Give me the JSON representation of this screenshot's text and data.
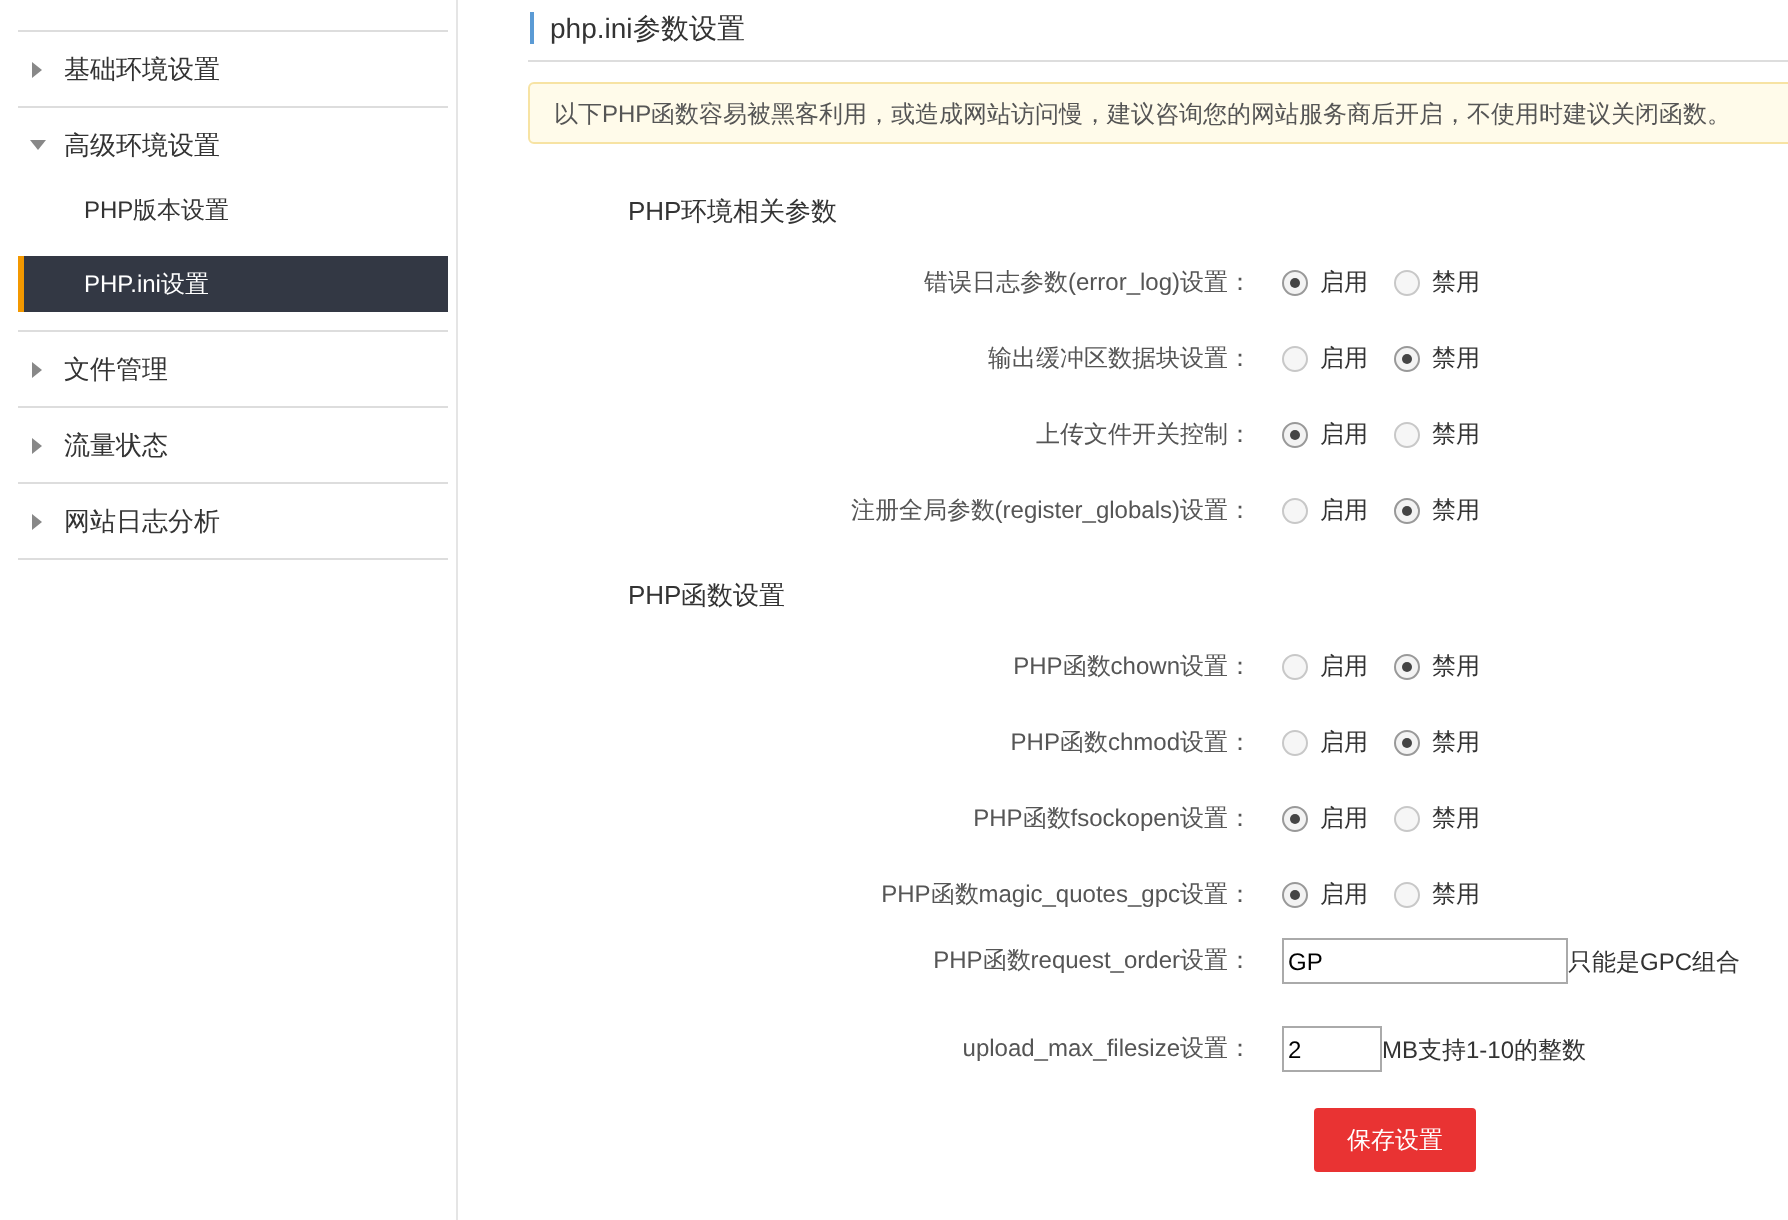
{
  "sidebar": {
    "items": [
      {
        "label": "基础环境设置",
        "expanded": false,
        "selected": false
      },
      {
        "label": "高级环境设置",
        "expanded": true,
        "selected": false,
        "children": [
          {
            "label": "PHP版本设置",
            "selected": false
          },
          {
            "label": "PHP.ini设置",
            "selected": true
          }
        ]
      },
      {
        "label": "文件管理",
        "expanded": false,
        "selected": false
      },
      {
        "label": "流量状态",
        "expanded": false,
        "selected": false
      },
      {
        "label": "网站日志分析",
        "expanded": false,
        "selected": false
      }
    ]
  },
  "page_title": "php.ini参数设置",
  "notice": "以下PHP函数容易被黑客利用，或造成网站访问慢，建议咨询您的网站服务商后开启，不使用时建议关闭函数。",
  "sections": [
    {
      "heading": "PHP环境相关参数",
      "rows": [
        {
          "kind": "radio",
          "label": "错误日志参数(error_log)设置：",
          "options": [
            {
              "label": "启用",
              "selected": true
            },
            {
              "label": "禁用",
              "selected": false
            }
          ]
        },
        {
          "kind": "radio",
          "label": "输出缓冲区数据块设置：",
          "options": [
            {
              "label": "启用",
              "selected": false
            },
            {
              "label": "禁用",
              "selected": true
            }
          ]
        },
        {
          "kind": "radio",
          "label": "上传文件开关控制：",
          "options": [
            {
              "label": "启用",
              "selected": true
            },
            {
              "label": "禁用",
              "selected": false
            }
          ]
        },
        {
          "kind": "radio",
          "label": "注册全局参数(register_globals)设置：",
          "options": [
            {
              "label": "启用",
              "selected": false
            },
            {
              "label": "禁用",
              "selected": true
            }
          ]
        }
      ]
    },
    {
      "heading": "PHP函数设置",
      "rows": [
        {
          "kind": "radio",
          "label": "PHP函数chown设置：",
          "options": [
            {
              "label": "启用",
              "selected": false
            },
            {
              "label": "禁用",
              "selected": true
            }
          ]
        },
        {
          "kind": "radio",
          "label": "PHP函数chmod设置：",
          "options": [
            {
              "label": "启用",
              "selected": false
            },
            {
              "label": "禁用",
              "selected": true
            }
          ]
        },
        {
          "kind": "radio",
          "label": "PHP函数fsockopen设置：",
          "options": [
            {
              "label": "启用",
              "selected": true
            },
            {
              "label": "禁用",
              "selected": false
            }
          ]
        },
        {
          "kind": "radio",
          "label": "PHP函数magic_quotes_gpc设置：",
          "options": [
            {
              "label": "启用",
              "selected": true
            },
            {
              "label": "禁用",
              "selected": false
            }
          ]
        },
        {
          "kind": "wide_text",
          "label": "PHP函数request_order设置：",
          "value": "GP",
          "hint": "只能是GPC组合"
        },
        {
          "kind": "short_text",
          "label": "upload_max_filesize设置：",
          "value": "2",
          "hint": "MB支持1-10的整数"
        }
      ]
    }
  ],
  "save_button": "保存设置"
}
